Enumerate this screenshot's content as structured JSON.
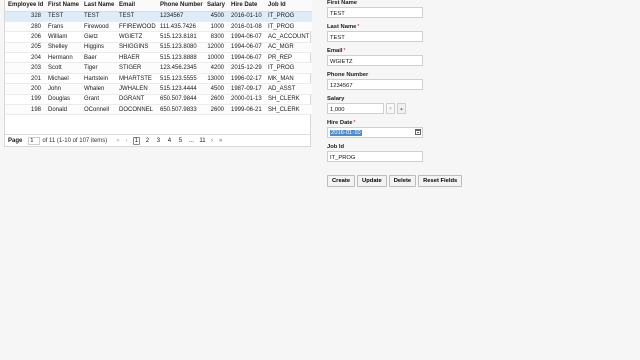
{
  "table": {
    "columns": [
      "Employee Id",
      "First Name",
      "Last Name",
      "Email",
      "Phone Number",
      "Salary",
      "Hire Date",
      "Job Id"
    ],
    "rows": [
      [
        "328",
        "TEST",
        "TEST",
        "TEST",
        "1234567",
        "4500",
        "2016-01-10",
        "IT_PROG"
      ],
      [
        "280",
        "Frans",
        "Firewood",
        "FFIREWOOD",
        "111.435.7426",
        "1000",
        "2016-01-08",
        "IT_PROG"
      ],
      [
        "206",
        "William",
        "Gietz",
        "WGIETZ",
        "515.123.8181",
        "8300",
        "1994-06-07",
        "AC_ACCOUNT"
      ],
      [
        "205",
        "Shelley",
        "Higgins",
        "SHIGGINS",
        "515.123.8080",
        "12000",
        "1994-06-07",
        "AC_MGR"
      ],
      [
        "204",
        "Hermann",
        "Baer",
        "HBAER",
        "515.123.8888",
        "10000",
        "1994-06-07",
        "PR_REP"
      ],
      [
        "203",
        "Scott",
        "Tiger",
        "STIGER",
        "123.456.2345",
        "4200",
        "2015-12-29",
        "IT_PROG"
      ],
      [
        "201",
        "Michael",
        "Hartstein",
        "MHARTSTE",
        "515.123.5555",
        "13000",
        "1996-02-17",
        "MK_MAN"
      ],
      [
        "200",
        "John",
        "Whalen",
        "JWHALEN",
        "515.123.4444",
        "4500",
        "1987-09-17",
        "AD_ASST"
      ],
      [
        "199",
        "Douglas",
        "Grant",
        "DGRANT",
        "650.507.9844",
        "2600",
        "2000-01-13",
        "SH_CLERK"
      ],
      [
        "198",
        "Donald",
        "OConnell",
        "DOCONNEL",
        "650.507.9833",
        "2600",
        "1999-06-21",
        "SH_CLERK"
      ]
    ]
  },
  "pager": {
    "label": "Page",
    "current": "1",
    "summary": "of 11 (1-10 of 107 items)",
    "first": "«",
    "prev": "‹",
    "pages": [
      "1",
      "2",
      "3",
      "4",
      "5",
      "...",
      "11"
    ],
    "next": "›",
    "last": "»"
  },
  "form": {
    "first_name": {
      "label": "First Name",
      "value": "TEST"
    },
    "last_name": {
      "label": "Last Name",
      "value": "TEST",
      "required": "*"
    },
    "email": {
      "label": "Email",
      "value": "WGIETZ",
      "required": "*"
    },
    "phone": {
      "label": "Phone Number",
      "value": "1234567"
    },
    "salary": {
      "label": "Salary",
      "value": "1,000",
      "down": "▾",
      "up": "▴"
    },
    "hire_date": {
      "label": "Hire Date",
      "value": "2016-01-10",
      "required": "*"
    },
    "job_id": {
      "label": "Job Id",
      "value": "IT_PROG"
    }
  },
  "buttons": {
    "create": "Create",
    "update": "Update",
    "delete": "Delete",
    "reset": "Reset Fields"
  },
  "colors": {
    "selected_row": "#dcecf9",
    "required": "#cc0000",
    "date_highlight": "#4d8bd3"
  }
}
